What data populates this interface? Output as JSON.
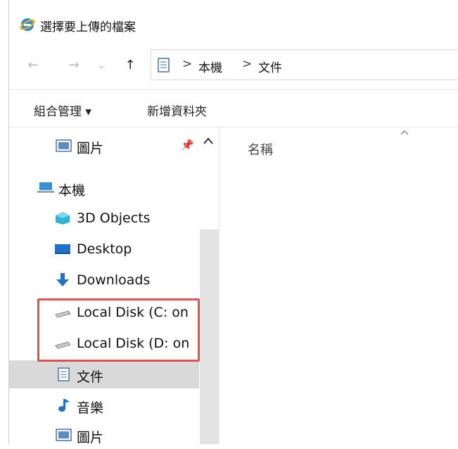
{
  "window": {
    "title": "選擇要上傳的檔案",
    "app_icon": "ie-icon"
  },
  "navigation": {
    "back": "←",
    "forward": "→",
    "recent": "⌄",
    "up": "↑"
  },
  "breadcrumb": {
    "separator": ">",
    "items": [
      "本機",
      "文件"
    ]
  },
  "toolbar": {
    "organize_label": "組合管理 ▾",
    "new_folder_label": "新增資料夾"
  },
  "nav_pane": {
    "items": [
      {
        "label": "圖片",
        "icon": "pictures-icon",
        "pinned": true
      },
      {
        "label": "本機",
        "icon": "this-pc-icon"
      },
      {
        "label": "3D Objects",
        "icon": "3d-objects-icon"
      },
      {
        "label": "Desktop",
        "icon": "desktop-icon"
      },
      {
        "label": "Downloads",
        "icon": "downloads-icon"
      },
      {
        "label": "Local Disk (C: on",
        "icon": "drive-icon"
      },
      {
        "label": "Local Disk (D: on",
        "icon": "drive-icon"
      },
      {
        "label": "文件",
        "icon": "documents-icon",
        "selected": true
      },
      {
        "label": "音樂",
        "icon": "music-icon"
      },
      {
        "label": "圖片",
        "icon": "pictures-icon"
      }
    ]
  },
  "content": {
    "column_header": "名稱"
  },
  "colors": {
    "highlight": "#e05252",
    "selected_bg": "#d9d9d9"
  }
}
